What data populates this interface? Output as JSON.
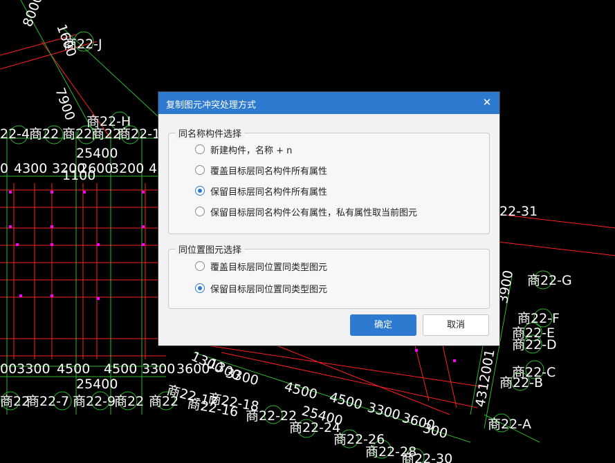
{
  "cad": {
    "labels": [
      "8000",
      "1600",
      "商22-J",
      "7900",
      "商22-H",
      "22-4",
      "商22",
      "商22",
      "商22",
      "商22-1",
      "25400",
      "0",
      "4300",
      "3200",
      "2600",
      "3200",
      "4",
      "1100",
      "22-31",
      "商22-G",
      "3900",
      "商22-F",
      "商22-E",
      "商22-D",
      "商22-C",
      "商22-B",
      "4312001",
      "003300",
      "4500",
      "4500",
      "3300",
      "3600",
      "1300",
      "1300",
      "25400",
      "3300",
      "4500",
      "25400",
      "4500",
      "3300",
      "3600",
      "300",
      "商22",
      "商22-7",
      "商22-9",
      "商22",
      "商22",
      "商22-17",
      "商22-16",
      "商22-18",
      "商22-22",
      "商22-24",
      "商22-26",
      "商22-28",
      "商22-30",
      "商22-A"
    ],
    "colors": {
      "grid": "#ff2020",
      "axis": "#2eb82e",
      "marker": "#ff00ff",
      "text": "#ffffff"
    }
  },
  "dialog": {
    "title": "复制图元冲突处理方式",
    "close_glyph": "✕",
    "group1": {
      "legend": "同名称构件选择",
      "options": [
        {
          "label": "新建构件，名称 + n",
          "selected": false
        },
        {
          "label": "覆盖目标层同名构件所有属性",
          "selected": false
        },
        {
          "label": "保留目标层同名构件所有属性",
          "selected": true
        },
        {
          "label": "保留目标层同名构件公有属性，私有属性取当前图元",
          "selected": false
        }
      ]
    },
    "group2": {
      "legend": "同位置图元选择",
      "options": [
        {
          "label": "覆盖目标层同位置同类型图元",
          "selected": false
        },
        {
          "label": "保留目标层同位置同类型图元",
          "selected": true
        }
      ]
    },
    "ok_label": "确定",
    "cancel_label": "取消",
    "accent_color": "#2e7ad1"
  }
}
